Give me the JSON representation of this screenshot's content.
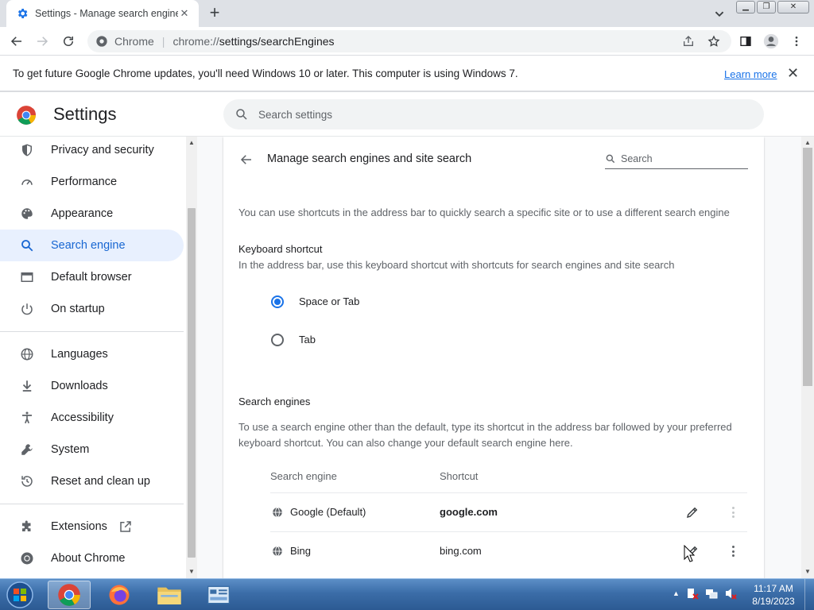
{
  "browser": {
    "tab_title": "Settings - Manage search engine",
    "new_tab_label": "+",
    "address_site": "Chrome",
    "address_url": "chrome://settings/searchEngines",
    "address_url_host": "chrome://",
    "address_url_path": "settings/searchEngines"
  },
  "infobar": {
    "message": "To get future Google Chrome updates, you'll need Windows 10 or later. This computer is using Windows 7.",
    "link": "Learn more"
  },
  "settings": {
    "title": "Settings",
    "search_placeholder": "Search settings"
  },
  "sidebar": {
    "items": [
      {
        "label": "Privacy and security",
        "icon": "shield-icon"
      },
      {
        "label": "Performance",
        "icon": "speedometer-icon"
      },
      {
        "label": "Appearance",
        "icon": "palette-icon"
      },
      {
        "label": "Search engine",
        "icon": "search-icon",
        "active": true
      },
      {
        "label": "Default browser",
        "icon": "browser-icon"
      },
      {
        "label": "On startup",
        "icon": "power-icon"
      },
      {
        "label": "Languages",
        "icon": "globe-icon"
      },
      {
        "label": "Downloads",
        "icon": "download-icon"
      },
      {
        "label": "Accessibility",
        "icon": "accessibility-icon"
      },
      {
        "label": "System",
        "icon": "wrench-icon"
      },
      {
        "label": "Reset and clean up",
        "icon": "reset-icon"
      },
      {
        "label": "Extensions",
        "icon": "puzzle-icon"
      },
      {
        "label": "About Chrome",
        "icon": "chrome-icon"
      }
    ]
  },
  "page": {
    "title": "Manage search engines and site search",
    "search_placeholder": "Search",
    "intro": "You can use shortcuts in the address bar to quickly search a specific site or to use a different search engine",
    "keyboard_shortcut": {
      "heading": "Keyboard shortcut",
      "description": "In the address bar, use this keyboard shortcut with shortcuts for search engines and site search",
      "options": [
        {
          "label": "Space or Tab",
          "checked": true
        },
        {
          "label": "Tab",
          "checked": false
        }
      ]
    },
    "search_engines": {
      "heading": "Search engines",
      "description_line1": "To use a search engine other than the default, type its shortcut in the address bar followed by your preferred",
      "description_line2": "keyboard shortcut. You can also change your default search engine here.",
      "columns": [
        "Search engine",
        "Shortcut"
      ],
      "rows": [
        {
          "name": "Google (Default)",
          "shortcut": "google.com",
          "bold": true
        },
        {
          "name": "Bing",
          "shortcut": "bing.com",
          "bold": false
        }
      ]
    }
  },
  "taskbar": {
    "time": "11:17 AM",
    "date": "8/19/2023"
  },
  "colors": {
    "accent": "#1a73e8",
    "active_nav_bg": "#e8f0fe",
    "active_nav_text": "#1967d2"
  }
}
